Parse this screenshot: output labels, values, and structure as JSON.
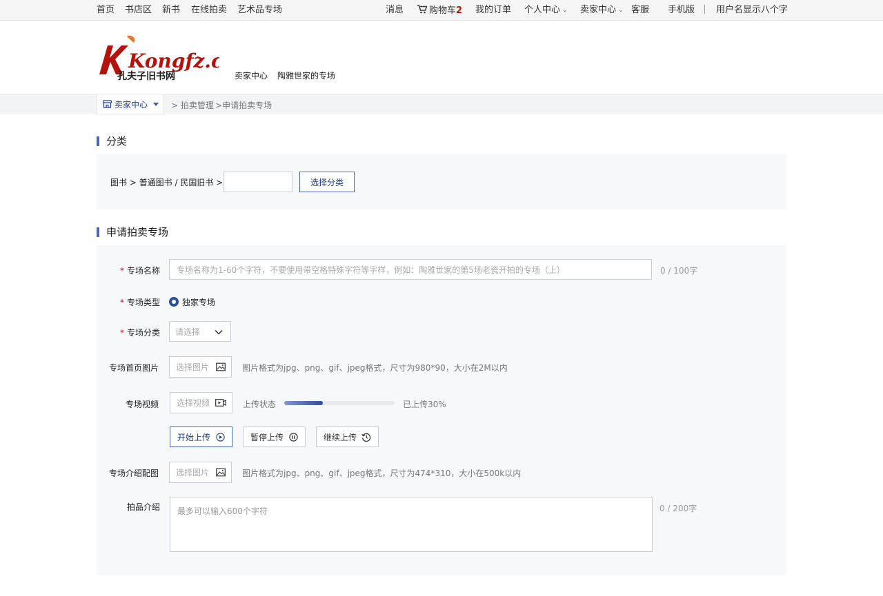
{
  "topbar": {
    "left_links": [
      "首页",
      "书店区",
      "新书",
      "在线拍卖",
      "艺术品专场"
    ],
    "messages": "消息",
    "cart_label": "购物车",
    "cart_count": "2",
    "orders": "我的订单",
    "personal_center": "个人中心",
    "seller_center": "卖家中心",
    "service": "客服",
    "mobile": "手机版",
    "username": "用户名显示八个字"
  },
  "header": {
    "logo_text": "Kongfz.com",
    "logo_sub": "孔夫子旧书网",
    "link_seller": "卖家中心",
    "link_shop": "陶雅世家的专场"
  },
  "breadcrumb": {
    "dropdown_label": "卖家中心",
    "items": [
      "拍卖管理",
      "申请拍卖专场"
    ]
  },
  "category_section": {
    "title": "分类",
    "path": "图书 > 普通图书 / 民国旧书 >",
    "input_value": "",
    "button": "选择分类"
  },
  "apply_section": {
    "title": "申请拍卖专场",
    "name_label": "专场名称",
    "name_placeholder": "专场名称为1-60个字符，不要使用带空格特殊字符等字样，例如：陶雅世家的第5场老瓷开拍的专场（上）",
    "name_counter": "0 / 100字",
    "type_label": "专场类型",
    "type_option": "独家专场",
    "category_label": "专场分类",
    "category_placeholder": "请选择",
    "cover_label": "专场首页图片",
    "cover_picker": "选择图片",
    "cover_hint": "图片格式为jpg、png、gif、jpeg格式，尺寸为980*90，大小在2M以内",
    "video_label": "专场视频",
    "video_picker": "选择视频",
    "upload_status_label": "上传状态",
    "upload_progress": 0.35,
    "upload_text": "已上传30%",
    "btn_start": "开始上传",
    "btn_pause": "暂停上传",
    "btn_resume": "继续上传",
    "intro_img_label": "专场介绍配图",
    "intro_img_picker": "选择图片",
    "intro_img_hint": "图片格式为jpg、png、gif、jpeg格式，尺寸为474*310，大小在500k以内",
    "desc_label": "拍品介绍",
    "desc_placeholder": "最多可以输入600个字符",
    "desc_counter": "0 / 200字"
  },
  "colors": {
    "accent": "#2d4f9e",
    "required": "#c8161d",
    "logo_red": "#b5120c",
    "panel_bg": "#f7f8fa"
  }
}
